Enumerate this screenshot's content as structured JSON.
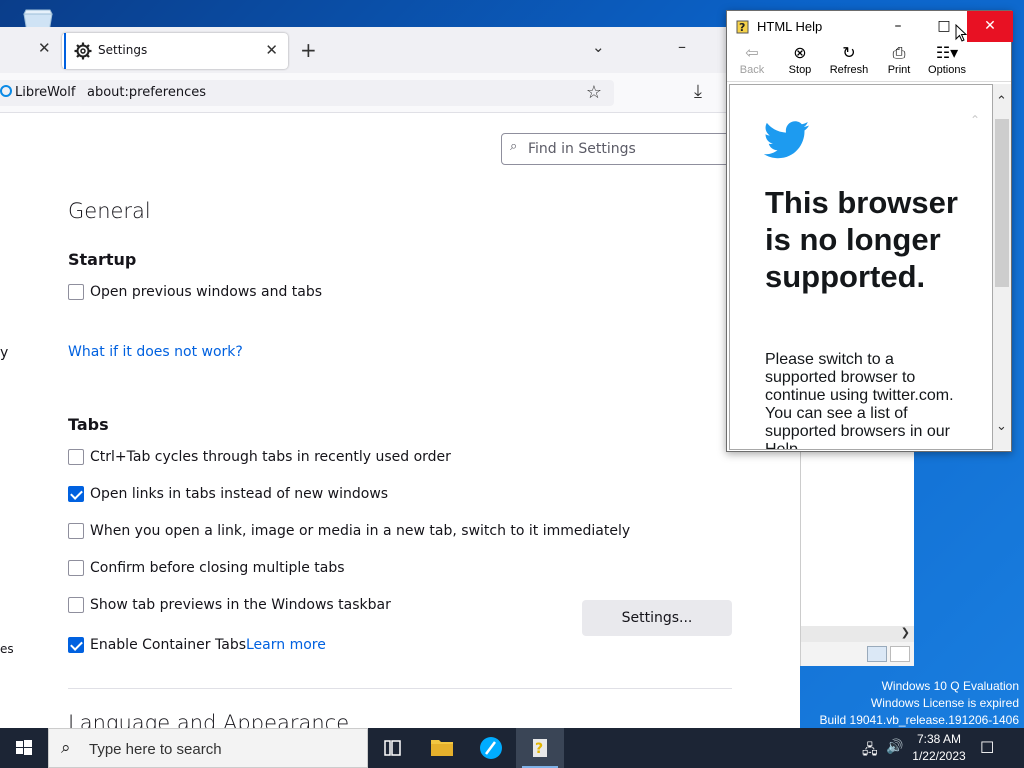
{
  "desktop": {
    "watermark": [
      "Windows 10 Q Evaluation",
      "Windows License is expired",
      "Build 19041.vb_release.191206-1406"
    ]
  },
  "browser": {
    "app_name": "LibreWolf",
    "tab_title": "Settings",
    "url": "about:preferences",
    "search_placeholder": "Find in Settings",
    "section_general": "General",
    "startup_heading": "Startup",
    "startup_option": "Open previous windows and tabs",
    "startup_link": "What if it does not work?",
    "tabs_heading": "Tabs",
    "tab_options": [
      {
        "label": "Ctrl+Tab cycles through tabs in recently used order",
        "checked": false
      },
      {
        "label": "Open links in tabs instead of new windows",
        "checked": true
      },
      {
        "label": "When you open a link, image or media in a new tab, switch to it immediately",
        "checked": false
      },
      {
        "label": "Confirm before closing multiple tabs",
        "checked": false
      },
      {
        "label": "Show tab previews in the Windows taskbar",
        "checked": false
      },
      {
        "label": "Enable Container Tabs",
        "checked": true
      }
    ],
    "learn_more": "Learn more",
    "settings_button": "Settings...",
    "section_language": "Language and Appearance",
    "side_fragment_1": "y",
    "side_fragment_2": "es"
  },
  "help": {
    "title": "HTML Help",
    "toolbar": {
      "back": "Back",
      "stop": "Stop",
      "refresh": "Refresh",
      "print": "Print",
      "options": "Options"
    },
    "headline": "This browser is no longer supported.",
    "body": "Please switch to a supported browser to continue using twitter.com. You can see a list of supported browsers in our Help"
  },
  "taskbar": {
    "search_placeholder": "Type here to search",
    "time": "7:38 AM",
    "date": "1/22/2023"
  },
  "colors": {
    "accent": "#0061e0",
    "twitter_blue": "#1d9bf0",
    "close_red": "#e81123",
    "taskbar": "#1c2535"
  }
}
